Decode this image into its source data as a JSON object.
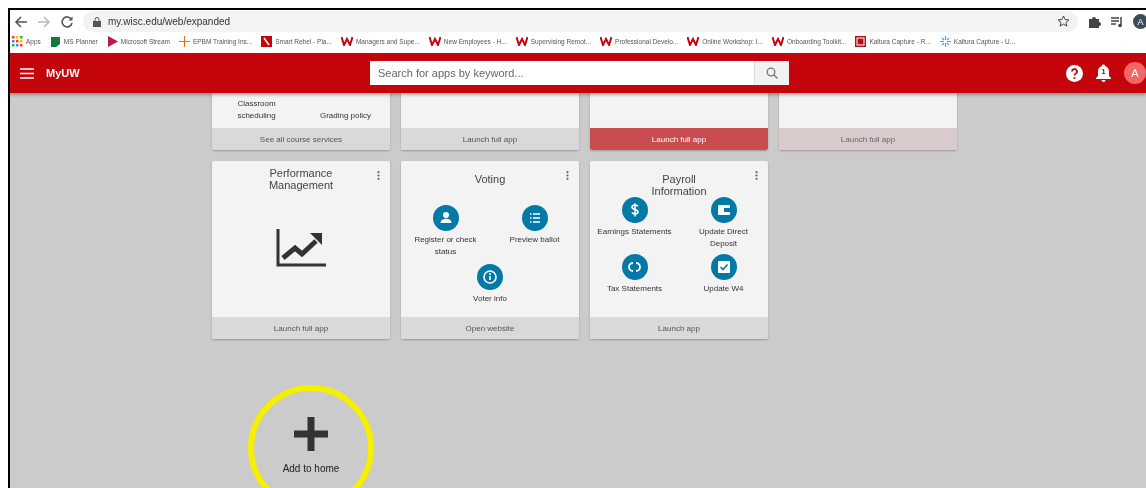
{
  "browser": {
    "url": "my.wisc.edu/web/expanded",
    "profile_initial": "A",
    "bookmarks": [
      {
        "label": "Apps",
        "kind": "apps"
      },
      {
        "label": "MS Planner",
        "kind": "planner"
      },
      {
        "label": "Microsoft Stream",
        "kind": "stream"
      },
      {
        "label": "EPBM Training Ins...",
        "kind": "cross"
      },
      {
        "label": "Smart Rebel - Pla...",
        "kind": "redsquare"
      },
      {
        "label": "Managers and Supe...",
        "kind": "w"
      },
      {
        "label": "New Employees - H...",
        "kind": "w"
      },
      {
        "label": "Supervising Remot...",
        "kind": "w"
      },
      {
        "label": "Professional Develo...",
        "kind": "w"
      },
      {
        "label": "Online Workshop: I...",
        "kind": "w"
      },
      {
        "label": "Onboarding Toolkit...",
        "kind": "w"
      },
      {
        "label": "Kaltura Capture - R...",
        "kind": "kaltura"
      },
      {
        "label": "Kaltura Capture - U...",
        "kind": "sparkle"
      }
    ]
  },
  "header": {
    "title": "MyUW",
    "search": {
      "placeholder": "Search for apps by keyword..."
    },
    "notification_count": "1",
    "avatar_initial": "A"
  },
  "cards_top": [
    {
      "tiles": [
        {
          "label": "Classroom scheduling"
        },
        {
          "label": "Grading policy"
        }
      ],
      "footer": {
        "label": "See all course services",
        "kind": "normal"
      }
    },
    {
      "footer": {
        "label": "Launch full app",
        "kind": "normal"
      }
    },
    {
      "footer": {
        "label": "Launch full app",
        "kind": "primary"
      }
    },
    {
      "footer": {
        "label": "Launch full app",
        "kind": "pale"
      }
    }
  ],
  "cards": [
    {
      "title": "Performance Management",
      "kind": "chart",
      "footer": {
        "label": "Launch full app",
        "kind": "normal"
      }
    },
    {
      "title": "Voting",
      "kind": "tiles",
      "tiles": [
        {
          "label": "Register or check status",
          "kind": "person"
        },
        {
          "label": "Preview ballot",
          "kind": "list"
        },
        {
          "label": "Voter info",
          "kind": "info"
        }
      ],
      "footer": {
        "label": "Open website",
        "kind": "normal"
      }
    },
    {
      "title": "Payroll Information",
      "kind": "tiles",
      "tiles": [
        {
          "label": "Earnings Statements",
          "kind": "dollar"
        },
        {
          "label": "Update Direct Deposit",
          "kind": "wallet"
        },
        {
          "label": "Tax Statements",
          "kind": "cycle"
        },
        {
          "label": "Update W4",
          "kind": "check"
        }
      ],
      "footer": {
        "label": "Launch app",
        "kind": "normal"
      }
    }
  ],
  "add_tile": {
    "label": "Add to home",
    "highlighted": true
  }
}
